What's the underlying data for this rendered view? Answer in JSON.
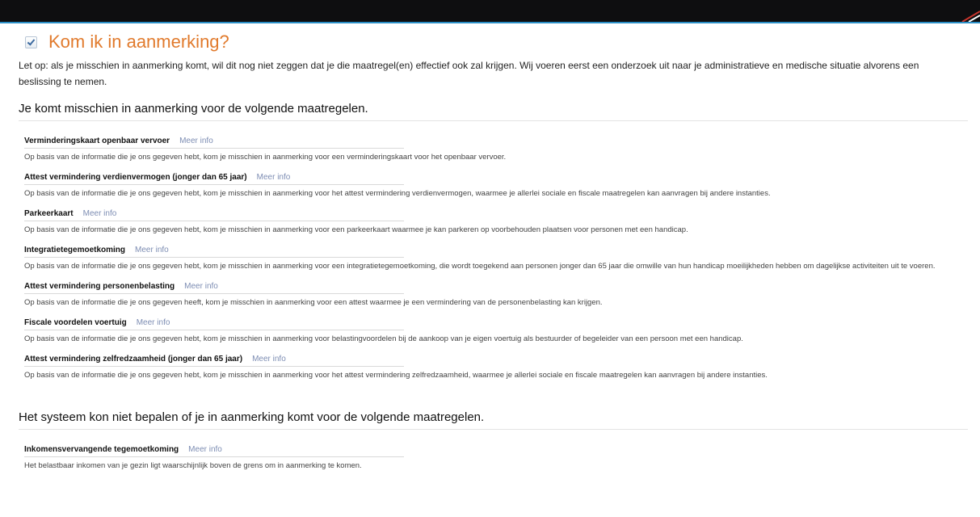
{
  "page": {
    "title": "Kom ik in aanmerking?",
    "intro": "Let op: als je misschien in aanmerking komt, wil dit nog niet zeggen dat je die maatregel(en) effectief ook zal krijgen. Wij voeren eerst een onderzoek uit naar je administratieve en medische situatie alvorens een beslissing te nemen."
  },
  "eligible": {
    "heading": "Je komt misschien in aanmerking voor de volgende maatregelen.",
    "items": [
      {
        "title": "Verminderingskaart openbaar vervoer",
        "link": "Meer info",
        "desc": "Op basis van de informatie die je ons gegeven hebt, kom je misschien in aanmerking voor een verminderingskaart voor het openbaar vervoer."
      },
      {
        "title": "Attest vermindering verdienvermogen (jonger dan 65 jaar)",
        "link": "Meer info",
        "desc": "Op basis van de informatie die je ons gegeven hebt, kom je misschien in aanmerking voor het attest vermindering verdienvermogen, waarmee je allerlei sociale en fiscale maatregelen kan aanvragen bij andere instanties."
      },
      {
        "title": "Parkeerkaart",
        "link": "Meer info",
        "desc": "Op basis van de informatie die je ons gegeven hebt, kom je misschien in aanmerking voor een parkeerkaart waarmee je kan parkeren op voorbehouden plaatsen voor personen met een handicap."
      },
      {
        "title": "Integratietegemoetkoming",
        "link": "Meer info",
        "desc": "Op basis van de informatie die je ons gegeven hebt, kom je misschien in aanmerking voor een integratietegemoetkoming, die wordt toegekend aan personen jonger dan 65 jaar die omwille van hun handicap moeilijkheden hebben om dagelijkse activiteiten uit te voeren."
      },
      {
        "title": "Attest vermindering personenbelasting",
        "link": "Meer info",
        "desc": "Op basis van de informatie die je ons gegeven heeft, kom je misschien in aanmerking voor een attest waarmee je een vermindering van de personenbelasting kan krijgen."
      },
      {
        "title": "Fiscale voordelen voertuig",
        "link": "Meer info",
        "desc": "Op basis van de informatie die je ons gegeven hebt, kom je misschien in aanmerking voor belastingvoordelen bij de aankoop van je eigen voertuig als bestuurder of begeleider van een persoon met een handicap."
      },
      {
        "title": "Attest vermindering zelfredzaamheid (jonger dan 65 jaar)",
        "link": "Meer info",
        "desc": "Op basis van de informatie die je ons gegeven hebt, kom je misschien in aanmerking voor het attest vermindering zelfredzaamheid, waarmee je allerlei sociale en fiscale maatregelen kan aanvragen bij andere instanties."
      }
    ]
  },
  "undetermined": {
    "heading": "Het systeem kon niet bepalen of je in aanmerking komt voor de volgende maatregelen.",
    "items": [
      {
        "title": "Inkomensvervangende tegemoetkoming",
        "link": "Meer info",
        "desc": "Het belastbaar inkomen van je gezin ligt waarschijnlijk boven de grens om in aanmerking te komen."
      }
    ]
  },
  "colors": {
    "title": "#e17a2c",
    "link": "#7d8db3",
    "topbar": "#0e0e10",
    "accent": "#2b8fc7"
  }
}
